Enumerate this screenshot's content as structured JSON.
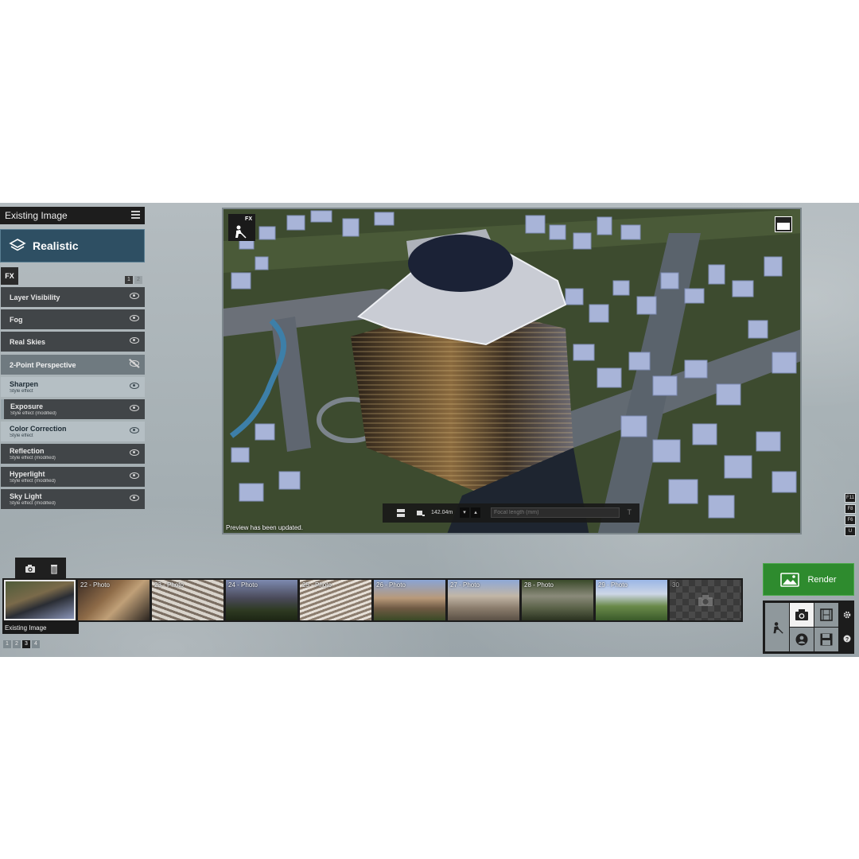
{
  "left_panel": {
    "title": "Existing Image",
    "style_name": "Realistic",
    "fx_tab": "FX",
    "fx_pages": [
      "1",
      "2"
    ],
    "effects": [
      {
        "name": "Layer Visibility",
        "sub": "",
        "visible": true
      },
      {
        "name": "Fog",
        "sub": "",
        "visible": true
      },
      {
        "name": "Real Skies",
        "sub": "",
        "visible": true
      },
      {
        "name": "2-Point Perspective",
        "sub": "",
        "visible": false
      },
      {
        "name": "Sharpen",
        "sub": "Style effect",
        "visible": true
      },
      {
        "name": "Exposure",
        "sub": "Style effect (modified)",
        "visible": true
      },
      {
        "name": "Color Correction",
        "sub": "Style effect",
        "visible": true
      },
      {
        "name": "Reflection",
        "sub": "Style effect (modified)",
        "visible": true
      },
      {
        "name": "Hyperlight",
        "sub": "Style effect (modified)",
        "visible": true
      },
      {
        "name": "Sky Light",
        "sub": "Style effect (modified)",
        "visible": true
      }
    ]
  },
  "viewport": {
    "fx_badge": "FX",
    "camera_distance": "142.04m",
    "focal_placeholder": "Focal length (mm)",
    "t_symbol": "T",
    "status": "Preview has been updated."
  },
  "hotkeys": [
    "F11",
    "F8",
    "F6",
    "U"
  ],
  "thumbnails": [
    {
      "label": "",
      "selected": true
    },
    {
      "label": "22 - Photo",
      "selected": false
    },
    {
      "label": "23 - Photo",
      "selected": false
    },
    {
      "label": "24 - Photo",
      "selected": false
    },
    {
      "label": "25 - Photo",
      "selected": false
    },
    {
      "label": "26 - Photo",
      "selected": false
    },
    {
      "label": "27 - Photo",
      "selected": false
    },
    {
      "label": "28 - Photo",
      "selected": false
    },
    {
      "label": "29 - Photo",
      "selected": false
    },
    {
      "label": "30",
      "selected": false
    }
  ],
  "tooltip": "Existing Image",
  "strip_pages": [
    "1",
    "2",
    "3",
    "4"
  ],
  "current_strip_page": "3",
  "render": {
    "label": "Render"
  },
  "colors": {
    "render_green": "#2e8b2e",
    "style_blue": "#2e4f63"
  }
}
